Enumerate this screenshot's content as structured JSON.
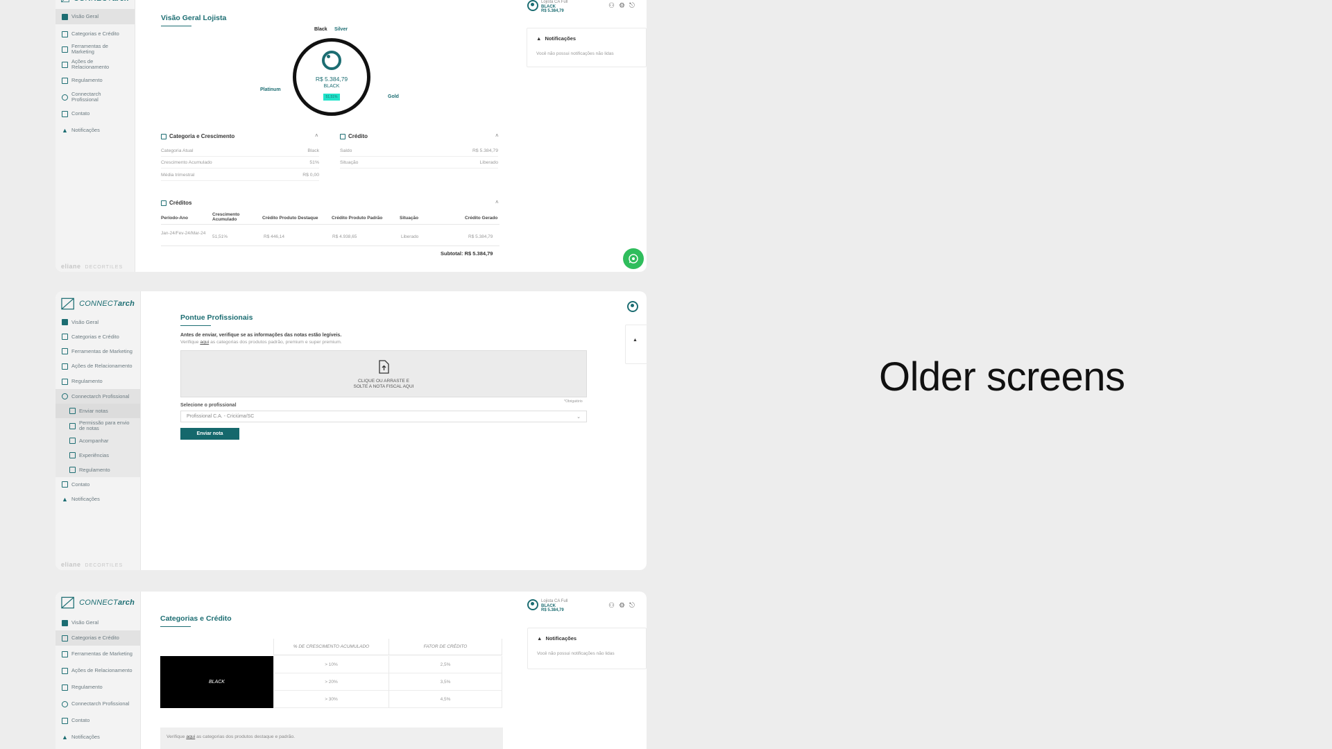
{
  "caption": "Older screens",
  "logo": {
    "prefix": "CONNECT",
    "suffix": "arch"
  },
  "footer_brand": {
    "main": "eliane",
    "secondary": "DECORTILES"
  },
  "user": {
    "name": "Lojista CA Full",
    "tier": "BLACK",
    "amount": "R$ 5.384,79"
  },
  "notifications": {
    "title": "Notificações",
    "empty": "Você não possui notificações não lidas"
  },
  "screen1": {
    "nav": [
      "Visão Geral",
      "Categorias e Crédito",
      "Ferramentas de Marketing",
      "Ações de Relacionamento",
      "Regulamento",
      "Connectarch Profissional",
      "Contato",
      "Notificações"
    ],
    "title": "Visão Geral Lojista",
    "gauge": {
      "top_left": "Black",
      "top_right": "Silver",
      "left": "Platinum",
      "right": "Gold",
      "amount": "R$ 5.384,79",
      "tier": "BLACK",
      "badge": "51,51%"
    },
    "category_section": {
      "title": "Categoria e Crescimento",
      "rows": [
        {
          "label": "Categoria Atual",
          "value": "Black"
        },
        {
          "label": "Crescimento Acumulado",
          "value": "51%"
        },
        {
          "label": "Média trimestral",
          "value": "R$ 0,00"
        }
      ]
    },
    "credit_section": {
      "title": "Crédito",
      "rows": [
        {
          "label": "Saldo",
          "value": "R$ 5.384,79"
        },
        {
          "label": "Situação",
          "value": "Liberado"
        }
      ]
    },
    "credits_table": {
      "title": "Créditos",
      "headers": [
        "Período-Ano",
        "Crescimento Acumulado",
        "Crédito Produto Destaque",
        "Crédito Produto Padrão",
        "Situação",
        "Crédito Gerado"
      ],
      "row": [
        "Jan-24/Fev-24/Mar-24",
        "51,51%",
        "R$ 446,14",
        "R$ 4.938,65",
        "Liberado",
        "R$ 5.384,79"
      ],
      "subtotal_label": "Subtotal:",
      "subtotal_value": "R$ 5.384,79"
    }
  },
  "screen2": {
    "nav": [
      "Visão Geral",
      "Categorias e Crédito",
      "Ferramentas de Marketing",
      "Ações de Relacionamento",
      "Regulamento",
      "Connectarch Profissional"
    ],
    "subnav": [
      "Enviar notas",
      "Permissão para envio de notas",
      "Acompanhar",
      "Experiências",
      "Regulamento"
    ],
    "nav_after": [
      "Contato",
      "Notificações"
    ],
    "title": "Pontue Profissionais",
    "warning": "Antes de enviar, verifique se as informações das notas estão legíveis.",
    "info_prefix": "Verifique",
    "info_link": "aqui",
    "info_suffix": "as categorias dos produtos padrão, premium e super premium.",
    "upload_line1": "CLIQUE OU ARRASTE E",
    "upload_line2": "SOLTE A NOTA FISCAL AQUI",
    "required": "*Obrigatório",
    "select_label": "Selecione o profissional",
    "select_value": "Profissional C.A. - Criciúma/SC",
    "button": "Enviar nota"
  },
  "screen3": {
    "nav": [
      "Visão Geral",
      "Categorias e Crédito",
      "Ferramentas de Marketing",
      "Ações de Relacionamento",
      "Regulamento",
      "Connectarch Profissional",
      "Contato",
      "Notificações"
    ],
    "title": "Categorias e Crédito",
    "headers": [
      "% DE CRESCIMENTO ACUMULADO",
      "FATOR DE CRÉDITO"
    ],
    "category": "BLACK",
    "rows": [
      [
        "> 10%",
        "2,5%"
      ],
      [
        "> 20%",
        "3,5%"
      ],
      [
        "> 30%",
        "4,5%"
      ]
    ],
    "info_prefix": "Verifique",
    "info_link": "aqui",
    "info_suffix": "as categorias dos produtos destaque e padrão."
  },
  "colors": {
    "brand": "#1c6d72",
    "button": "#15686c",
    "whatsapp": "#2fbd5c",
    "background": "#ededed"
  }
}
